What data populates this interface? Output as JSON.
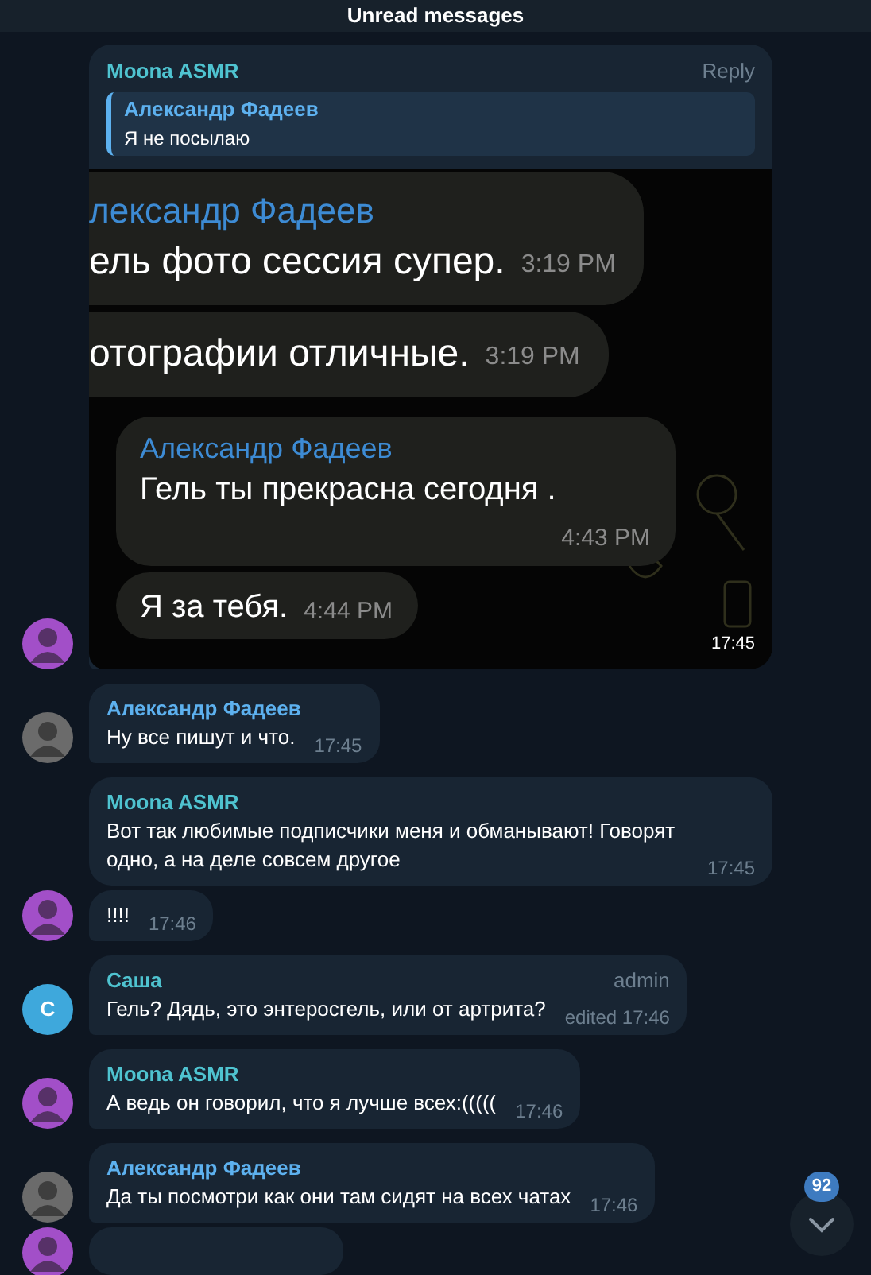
{
  "header": {
    "title": "Unread messages"
  },
  "messages": [
    {
      "name": "Moona ASMR",
      "color": "#4fc3d0",
      "badge": "Reply",
      "avatar": {
        "kind": "photo",
        "color": "#a24fc8"
      },
      "reply": {
        "name": "Александр Фадеев",
        "text": "Я не посылаю"
      },
      "screenshot": {
        "time": "17:45",
        "messages": [
          {
            "name": "лександр Фадеев",
            "text": "ель фото сессия супер.",
            "time": "3:19 PM",
            "cut": true
          },
          {
            "text": "отографии отличные.",
            "time": "3:19 PM",
            "cut": true
          },
          {
            "name": "Александр Фадеев",
            "text": "Гель ты прекрасна сегодня .",
            "time": "4:43 PM",
            "cut": false
          },
          {
            "text": "Я за тебя.",
            "time": "4:44 PM",
            "cut": false
          }
        ]
      }
    },
    {
      "name": "Александр Фадеев",
      "color": "#5db1ef",
      "avatar": {
        "kind": "photo",
        "color": "#6b6b6b"
      },
      "text": "Ну все пишут и что.",
      "time": "17:45"
    },
    {
      "name": "Moona ASMR",
      "color": "#4fc3d0",
      "text": "Вот так любимые подписчики меня и обманывают! Говорят одно, а на деле совсем другое",
      "time": "17:45"
    },
    {
      "avatar": {
        "kind": "photo",
        "color": "#a24fc8"
      },
      "text": "!!!!",
      "time": "17:46"
    },
    {
      "name": "Саша",
      "color": "#4fc3d0",
      "badge": "admin",
      "avatar": {
        "kind": "letter",
        "letter": "С",
        "color": "#3ea8dc"
      },
      "text": "Гель? Дядь, это энтеросгель, или от артрита?",
      "time": "edited 17:46"
    },
    {
      "name": "Moona ASMR",
      "color": "#4fc3d0",
      "avatar": {
        "kind": "photo",
        "color": "#a24fc8"
      },
      "text": "А ведь он говорил, что я лучше всех:(((((",
      "time": "17:46"
    },
    {
      "name": "Александр Фадеев",
      "color": "#5db1ef",
      "avatar": {
        "kind": "photo",
        "color": "#6b6b6b"
      },
      "text": "Да ты посмотри как они там сидят на всех чатах",
      "time": "17:46"
    },
    {
      "avatar": {
        "kind": "photo",
        "color": "#a24fc8"
      },
      "cut_off": true
    }
  ],
  "scroll_button": {
    "count": "92"
  }
}
